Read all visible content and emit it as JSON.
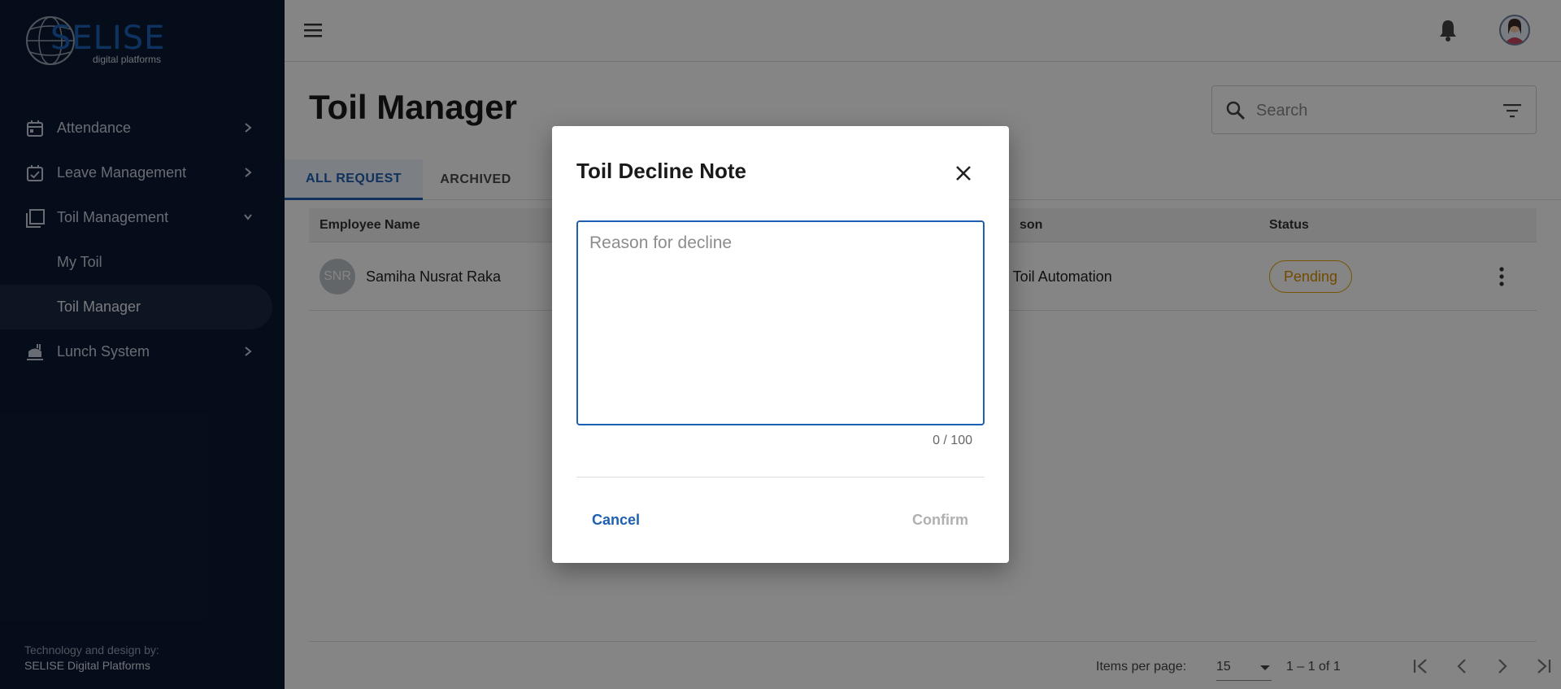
{
  "brand": {
    "logo_text": "SELISE",
    "logo_sub": "digital platforms",
    "accent": "#1d5fb0",
    "sidebar_bg": "#0b1a33"
  },
  "sidebar": {
    "items": [
      {
        "label": "Attendance",
        "icon": "calendar-icon"
      },
      {
        "label": "Leave Management",
        "icon": "calendar-check-icon"
      },
      {
        "label": "Toil Management",
        "icon": "copy-icon",
        "expanded": true,
        "children": [
          {
            "label": "My Toil"
          },
          {
            "label": "Toil Manager",
            "active": true
          }
        ]
      },
      {
        "label": "Lunch System",
        "icon": "food-icon"
      }
    ],
    "footer_line1": "Technology and design by:",
    "footer_line2": "SELISE Digital Platforms"
  },
  "header": {
    "menu_icon": "hamburger-menu-icon",
    "notification_icon": "bell-icon",
    "avatar_icon": "user-avatar-icon"
  },
  "page": {
    "title": "Toil Manager",
    "search_placeholder": "Search",
    "tabs": [
      {
        "label": "ALL REQUEST",
        "active": true
      },
      {
        "label": "ARCHIVED",
        "active": false
      }
    ]
  },
  "table": {
    "columns": {
      "employee": "Employee Name",
      "reason": "son",
      "status": "Status"
    },
    "rows": [
      {
        "initials": "SNR",
        "name": "Samiha Nusrat Raka",
        "reason": "t Toil Automation",
        "status": "Pending"
      }
    ]
  },
  "pager": {
    "items_per_page_label": "Items per page:",
    "items_per_page": "15",
    "range": "1 – 1 of 1"
  },
  "dialog": {
    "title": "Toil Decline Note",
    "placeholder": "Reason for decline",
    "counter": "0 / 100",
    "cancel": "Cancel",
    "confirm": "Confirm"
  }
}
